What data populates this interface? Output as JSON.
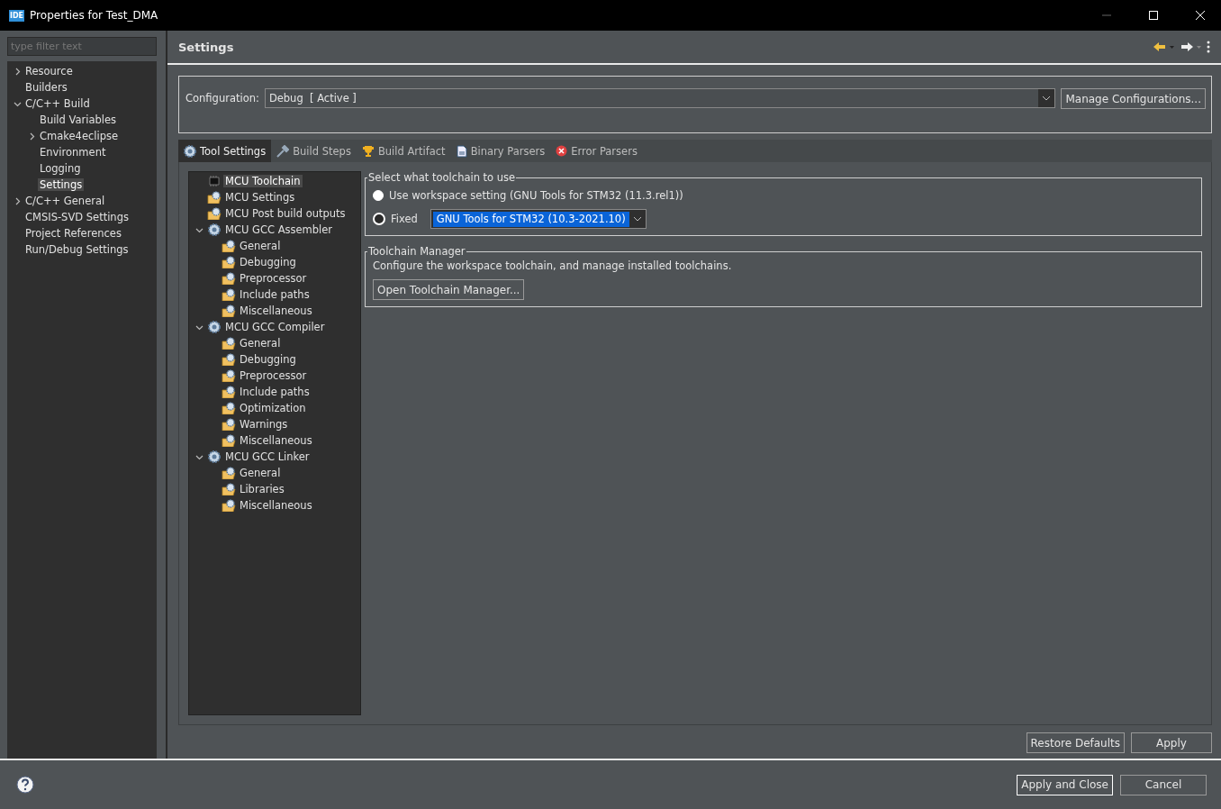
{
  "window": {
    "title": "Properties for Test_DMA",
    "app_badge": "IDE"
  },
  "filter": {
    "placeholder": "type filter text"
  },
  "nav": [
    {
      "label": "Resource",
      "expanded": false,
      "selected": false
    },
    {
      "label": "Builders",
      "selected": false
    },
    {
      "label": "C/C++ Build",
      "expanded": true,
      "selected": false,
      "children": [
        {
          "label": "Build Variables",
          "selected": false
        },
        {
          "label": "Cmake4eclipse",
          "expanded": false,
          "selected": false
        },
        {
          "label": "Environment",
          "selected": false
        },
        {
          "label": "Logging",
          "selected": false
        },
        {
          "label": "Settings",
          "selected": true
        }
      ]
    },
    {
      "label": "C/C++ General",
      "expanded": false,
      "selected": false
    },
    {
      "label": "CMSIS-SVD Settings",
      "selected": false
    },
    {
      "label": "Project References",
      "selected": false
    },
    {
      "label": "Run/Debug Settings",
      "selected": false
    }
  ],
  "page": {
    "title": "Settings"
  },
  "configuration": {
    "label": "Configuration:",
    "value": "Debug  [ Active ]",
    "button": "Manage Configurations..."
  },
  "tabs": [
    {
      "label": "Tool Settings",
      "kind": "tool",
      "selected": true
    },
    {
      "label": "Build Steps",
      "kind": "steps",
      "selected": false
    },
    {
      "label": "Build Artifact",
      "kind": "trophy",
      "selected": false
    },
    {
      "label": "Binary Parsers",
      "kind": "binary",
      "selected": false
    },
    {
      "label": "Error Parsers",
      "kind": "error",
      "selected": false
    }
  ],
  "tool_tree": [
    {
      "label": "MCU Toolchain",
      "kind": "chip",
      "selected": true
    },
    {
      "label": "MCU Settings",
      "kind": "folder",
      "selected": false
    },
    {
      "label": "MCU Post build outputs",
      "kind": "folder",
      "selected": false
    },
    {
      "label": "MCU GCC Assembler",
      "kind": "tool",
      "expanded": true,
      "selected": false,
      "children": [
        {
          "label": "General",
          "kind": "folder",
          "selected": false
        },
        {
          "label": "Debugging",
          "kind": "folder",
          "selected": false
        },
        {
          "label": "Preprocessor",
          "kind": "folder",
          "selected": false
        },
        {
          "label": "Include paths",
          "kind": "folder",
          "selected": false
        },
        {
          "label": "Miscellaneous",
          "kind": "folder",
          "selected": false
        }
      ]
    },
    {
      "label": "MCU GCC Compiler",
      "kind": "tool",
      "expanded": true,
      "selected": false,
      "children": [
        {
          "label": "General",
          "kind": "folder",
          "selected": false
        },
        {
          "label": "Debugging",
          "kind": "folder",
          "selected": false
        },
        {
          "label": "Preprocessor",
          "kind": "folder",
          "selected": false
        },
        {
          "label": "Include paths",
          "kind": "folder",
          "selected": false
        },
        {
          "label": "Optimization",
          "kind": "folder",
          "selected": false
        },
        {
          "label": "Warnings",
          "kind": "folder",
          "selected": false
        },
        {
          "label": "Miscellaneous",
          "kind": "folder",
          "selected": false
        }
      ]
    },
    {
      "label": "MCU GCC Linker",
      "kind": "tool",
      "expanded": true,
      "selected": false,
      "children": [
        {
          "label": "General",
          "kind": "folder",
          "selected": false
        },
        {
          "label": "Libraries",
          "kind": "folder",
          "selected": false
        },
        {
          "label": "Miscellaneous",
          "kind": "folder",
          "selected": false
        }
      ]
    }
  ],
  "toolchain_group": {
    "title": "Select what toolchain to use",
    "options": [
      {
        "label": "Use workspace setting (GNU Tools for STM32 (11.3.rel1))",
        "selected": false
      },
      {
        "label": "Fixed",
        "selected": true,
        "dropdown": "GNU Tools for STM32 (10.3-2021.10)"
      }
    ]
  },
  "manager_group": {
    "title": "Toolchain Manager",
    "text": "Configure the workspace toolchain, and manage installed toolchains.",
    "button": "Open Toolchain Manager..."
  },
  "page_buttons": [
    "Restore Defaults",
    "Apply"
  ],
  "dialog_buttons": [
    {
      "label": "Apply and Close",
      "default": true
    },
    {
      "label": "Cancel",
      "default": false
    }
  ]
}
